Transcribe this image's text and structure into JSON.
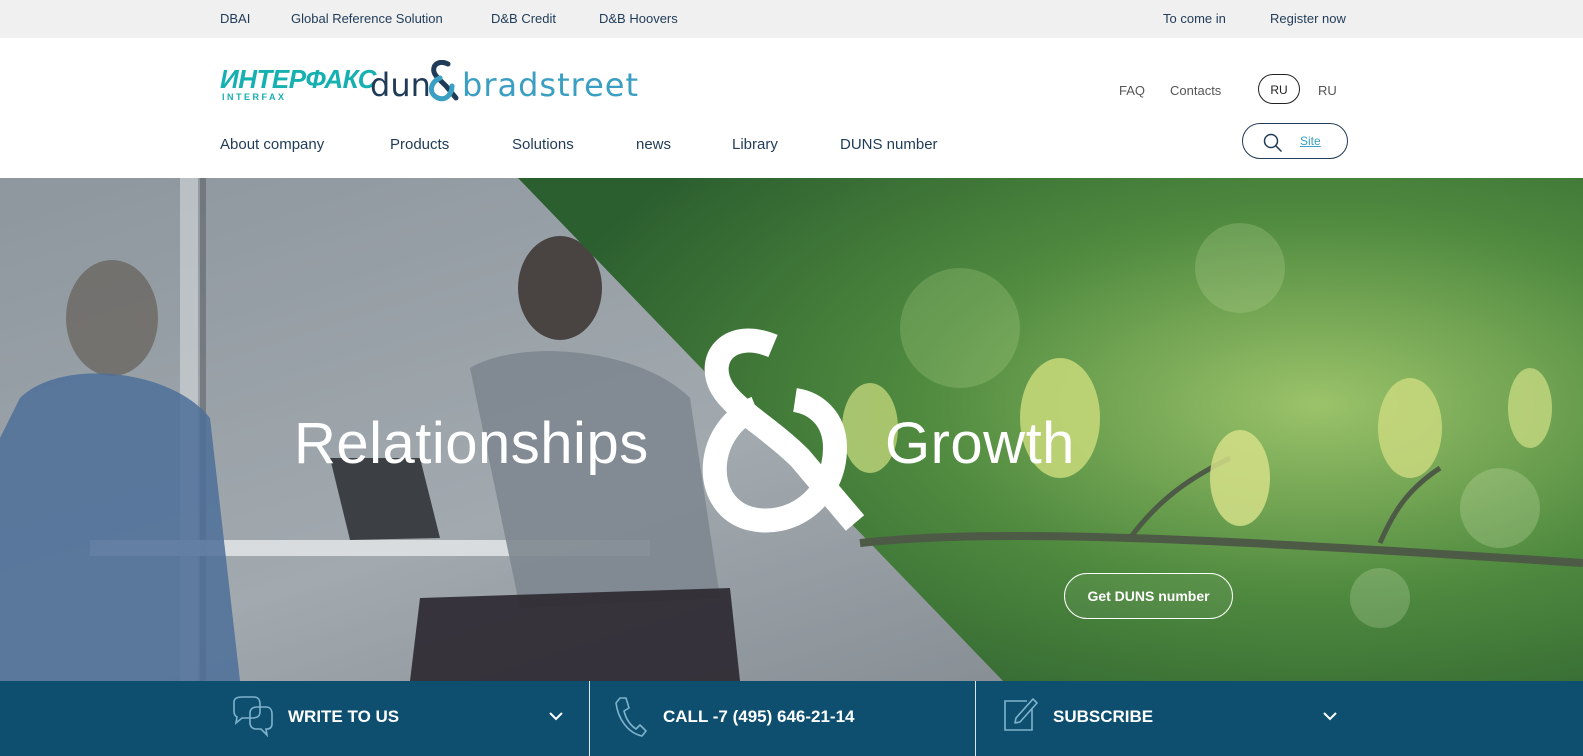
{
  "topbar": {
    "left_links": [
      "DBAI",
      "Global Reference Solution",
      "D&B Credit",
      "D&B Hoovers"
    ],
    "login": "To come in",
    "register": "Register now"
  },
  "header": {
    "logo_interfax_main": "ИНТЕРФАКС",
    "logo_interfax_sub": "INTERFAX",
    "logo_dnb_left": "dun",
    "logo_dnb_right": "bradstreet",
    "faq": "FAQ",
    "contacts": "Contacts",
    "lang_active": "RU",
    "lang_other": "RU",
    "nav": [
      "About company",
      "Products",
      "Solutions",
      "news",
      "Library",
      "DUNS number"
    ],
    "search_label": "Site"
  },
  "hero": {
    "left_text": "Relationships",
    "right_text": "Growth",
    "cta": "Get DUNS number"
  },
  "bottombar": {
    "write": "WRITE TO US",
    "call": "CALL -7 (495) 646-21-14",
    "subscribe": "SUBSCRIBE"
  },
  "colors": {
    "brand_dark": "#1f3b57",
    "brand_teal": "#15b0b0",
    "brand_blue": "#3a9fc2",
    "bottom_bar": "#0e4f70"
  }
}
